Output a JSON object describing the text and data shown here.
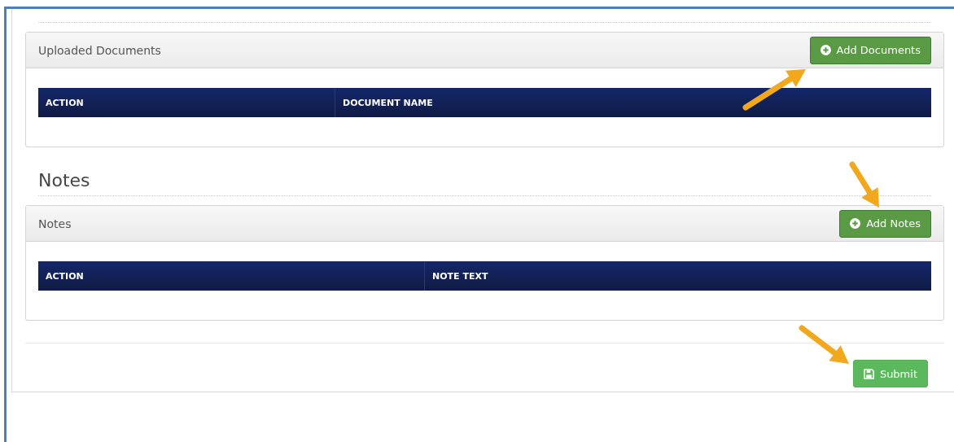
{
  "panels": [
    {
      "kind": "documents",
      "title": "Uploaded Documents",
      "button": {
        "label": "Add Documents"
      },
      "columns": [
        "ACTION",
        "DOCUMENT NAME"
      ]
    },
    {
      "kind": "notes",
      "heading": "Notes",
      "title": "Notes",
      "button": {
        "label": "Add Notes"
      },
      "columns": [
        "ACTION",
        "NOTE TEXT"
      ]
    }
  ],
  "submit": {
    "label": "Submit"
  }
}
